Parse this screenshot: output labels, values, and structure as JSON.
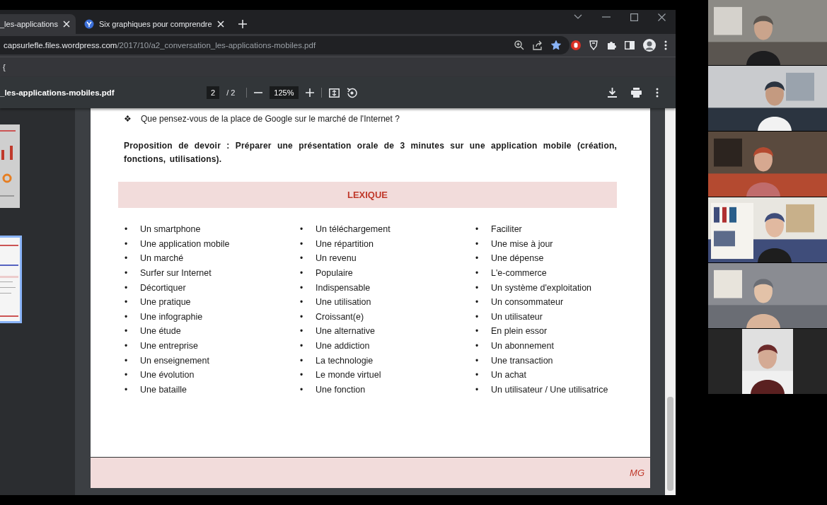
{
  "browser": {
    "tabs": [
      {
        "title": "_les-applications",
        "selected": true
      },
      {
        "title": "Six graphiques pour comprendre",
        "selected": false
      }
    ],
    "address": {
      "host": "capsurlefle.files.wordpress.com",
      "path": "/2017/10/a2_conversation_les-applications-mobiles.pdf",
      "bookmarked": true
    },
    "bookmarks": [
      "{"
    ]
  },
  "pdf_toolbar": {
    "filename": "_les-applications-mobiles.pdf",
    "page": "2",
    "page_count": "/ 2",
    "zoom": "125%"
  },
  "thumbnails": [
    {
      "selected": false
    },
    {
      "selected": true
    }
  ],
  "document": {
    "questions": [
      {
        "bullet": "❖",
        "text": "Que pensez-vous de la place de Google sur le marché de l'Internet ?"
      }
    ],
    "assignment": "Proposition de devoir : Préparer une présentation orale de 3 minutes sur une application mobile (création, fonctions, utilisations).",
    "lexique_title": "LEXIQUE",
    "bullet": "•",
    "lexique_columns": [
      [
        "Un smartphone",
        "Une application mobile",
        "Un marché",
        "Surfer sur Internet",
        "Décortiquer",
        "Une pratique",
        "Une infographie",
        "Une étude",
        "Une entreprise",
        "Un enseignement",
        "Une évolution",
        "Une bataille"
      ],
      [
        "Un téléchargement",
        "Une répartition",
        "Un revenu",
        "Populaire",
        "Indispensable",
        "Une utilisation",
        "Croissant(e)",
        "Une alternative",
        "Une addiction",
        "La technologie",
        "Le monde virtuel",
        "Une fonction"
      ],
      [
        "Faciliter",
        "Une mise à jour",
        "Une dépense",
        "L'e-commerce",
        "Un système d'exploitation",
        "Un consommateur",
        "Un utilisateur",
        "En plein essor",
        "Un abonnement",
        "Une transaction",
        "Un achat",
        "Un utilisateur / Une utilisatrice"
      ]
    ],
    "footer": "MG"
  }
}
